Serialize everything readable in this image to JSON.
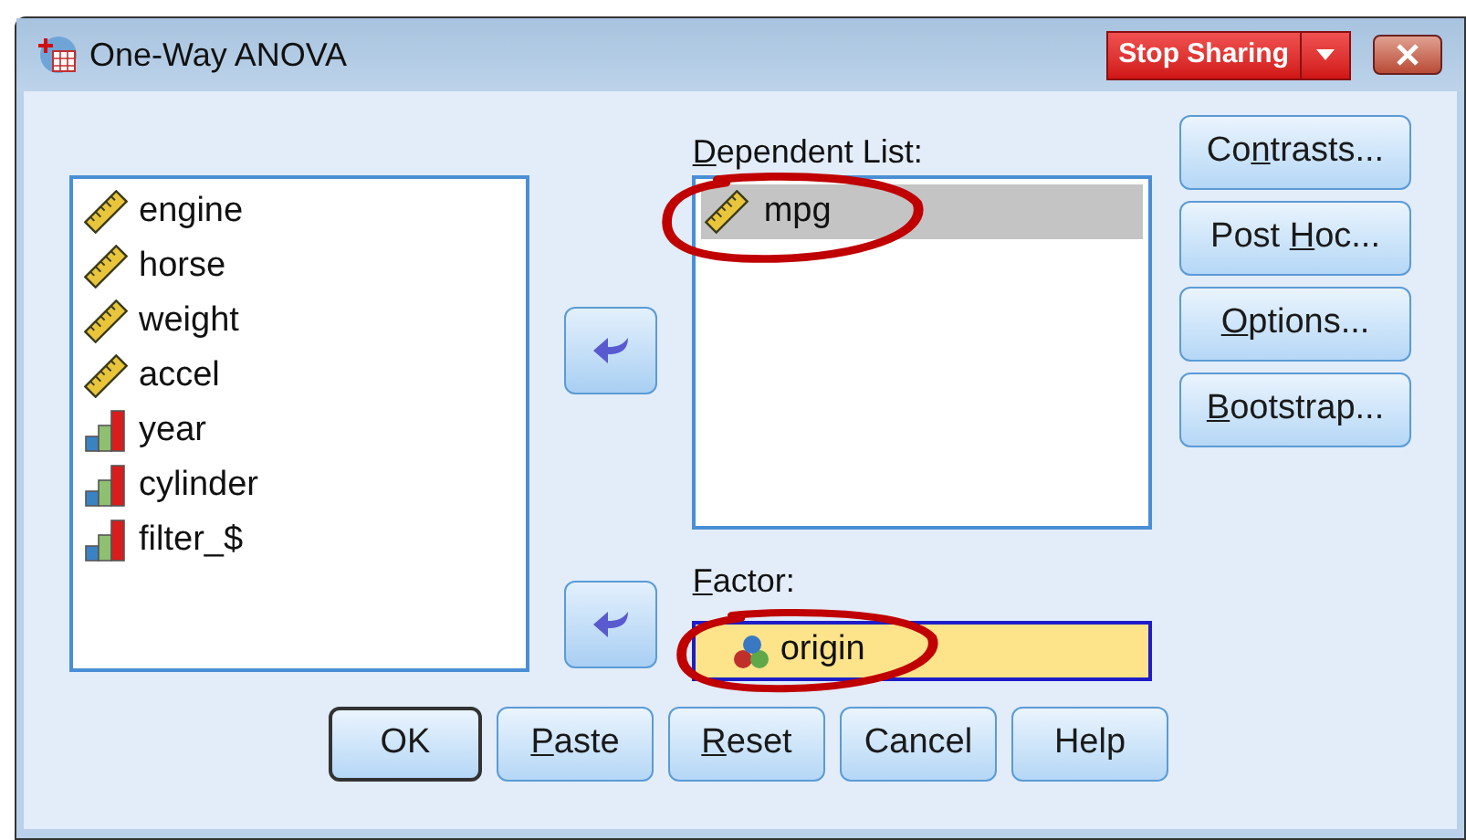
{
  "window": {
    "title": "One-Way ANOVA"
  },
  "sharing_button": {
    "label": "Stop Sharing"
  },
  "source_list": [
    {
      "name": "engine",
      "kind": "scale"
    },
    {
      "name": "horse",
      "kind": "scale"
    },
    {
      "name": "weight",
      "kind": "scale"
    },
    {
      "name": "accel",
      "kind": "scale"
    },
    {
      "name": "year",
      "kind": "ordinal"
    },
    {
      "name": "cylinder",
      "kind": "ordinal"
    },
    {
      "name": "filter_$",
      "kind": "ordinal"
    }
  ],
  "dependent_list": {
    "access_key": "D",
    "label_after": "ependent List:",
    "items": [
      {
        "name": "mpg",
        "kind": "scale",
        "selected": true,
        "circled": true
      }
    ]
  },
  "factor": {
    "access_key": "F",
    "label_after": "actor:",
    "value": "origin",
    "kind": "nominal",
    "circled": true
  },
  "side_buttons": [
    {
      "label_before": "Co",
      "access_key": "n",
      "label_after": "trasts..."
    },
    {
      "label_before": "Post ",
      "access_key": "H",
      "label_after": "oc..."
    },
    {
      "access_key": "O",
      "label_after": "ptions..."
    },
    {
      "access_key": "B",
      "label_after": "ootstrap..."
    }
  ],
  "bottom_buttons": [
    {
      "label_after": "OK",
      "default": true
    },
    {
      "access_key": "P",
      "label_after": "aste",
      "default": false
    },
    {
      "access_key": "R",
      "label_after": "eset",
      "default": false
    },
    {
      "label_after": "Cancel",
      "default": false
    },
    {
      "label_after": "Help",
      "default": false
    }
  ]
}
